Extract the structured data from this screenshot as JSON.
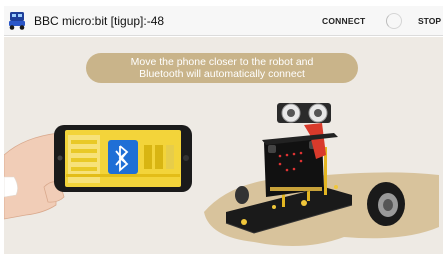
{
  "appbar": {
    "title": "BBC micro:bit [tigup]:-48",
    "connect_label": "CONNECT",
    "stop_label": "STOP"
  },
  "banner": {
    "line1": "Move the phone closer to the robot and",
    "line2": "Bluetooth will automatically connect"
  },
  "colors": {
    "background": "#eeeae4",
    "banner": "#c9b48a",
    "phone_screen": "#f3d43a",
    "bluetooth": "#1f6fd6",
    "sand": "#d8c39c",
    "robot_body": "#1a1a1a"
  },
  "icons": [
    "app-robot-icon",
    "connecting-spinner-icon",
    "bluetooth-icon"
  ]
}
